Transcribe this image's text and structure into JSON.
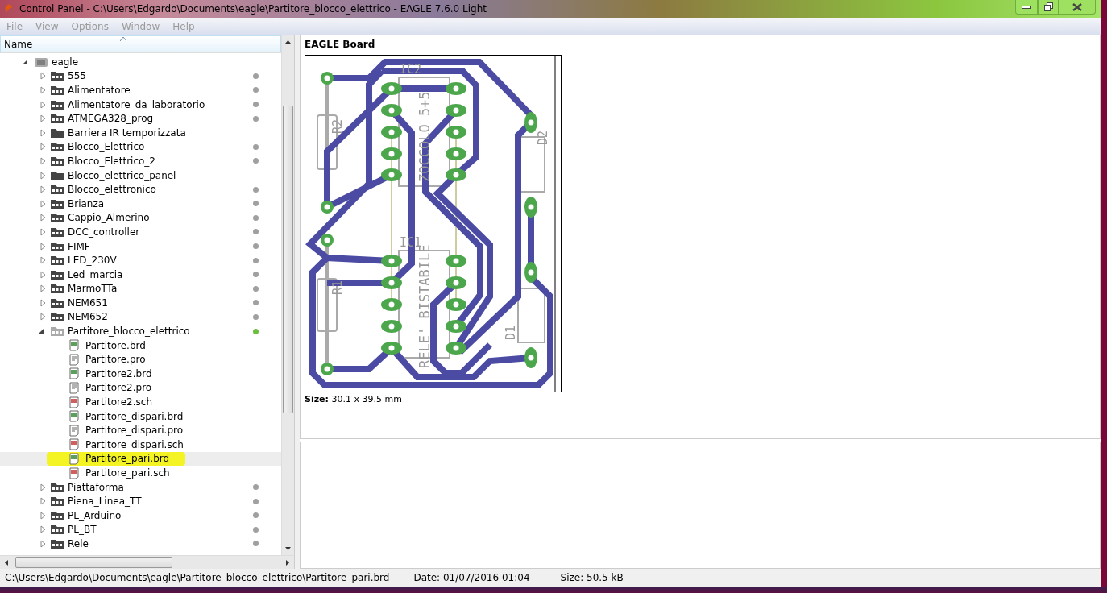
{
  "window": {
    "title": "Control Panel - C:\\Users\\Edgardo\\Documents\\eagle\\Partitore_blocco_elettrico - EAGLE 7.6.0 Light"
  },
  "menu": [
    "File",
    "View",
    "Options",
    "Window",
    "Help"
  ],
  "tree": {
    "column": "Name",
    "nodes": [
      {
        "name": "eagle",
        "kind": "root",
        "expanded": true,
        "selected": false,
        "children": [
          {
            "name": "555",
            "kind": "project",
            "expanded": false,
            "selected": false,
            "color": "#a0a0a0"
          },
          {
            "name": "Alimentatore",
            "kind": "project",
            "expanded": false,
            "selected": false,
            "color": "#a0a0a0"
          },
          {
            "name": "Alimentatore_da_laboratorio",
            "kind": "project",
            "expanded": false,
            "selected": false,
            "color": "#a0a0a0"
          },
          {
            "name": "ATMEGA328_prog",
            "kind": "project",
            "expanded": false,
            "selected": false,
            "color": "#a0a0a0"
          },
          {
            "name": "Barriera IR temporizzata",
            "kind": "folder",
            "expanded": false,
            "selected": false
          },
          {
            "name": "Blocco_Elettrico",
            "kind": "project",
            "expanded": false,
            "selected": false,
            "color": "#a0a0a0"
          },
          {
            "name": "Blocco_Elettrico_2",
            "kind": "project",
            "expanded": false,
            "selected": false,
            "color": "#a0a0a0"
          },
          {
            "name": "Blocco_elettrico_panel",
            "kind": "folder",
            "expanded": false,
            "selected": false
          },
          {
            "name": "Blocco_elettronico",
            "kind": "project",
            "expanded": false,
            "selected": false,
            "color": "#a0a0a0"
          },
          {
            "name": "Brianza",
            "kind": "project",
            "expanded": false,
            "selected": false,
            "color": "#a0a0a0"
          },
          {
            "name": "Cappio_Almerino",
            "kind": "project",
            "expanded": false,
            "selected": false,
            "color": "#a0a0a0"
          },
          {
            "name": "DCC_controller",
            "kind": "project",
            "expanded": false,
            "selected": false,
            "color": "#a0a0a0"
          },
          {
            "name": "FIMF",
            "kind": "project",
            "expanded": false,
            "selected": false,
            "color": "#a0a0a0"
          },
          {
            "name": "LED_230V",
            "kind": "project",
            "expanded": false,
            "selected": false,
            "color": "#a0a0a0"
          },
          {
            "name": "Led_marcia",
            "kind": "project",
            "expanded": false,
            "selected": false,
            "color": "#a0a0a0"
          },
          {
            "name": "MarmoTTa",
            "kind": "project",
            "expanded": false,
            "selected": false,
            "color": "#a0a0a0"
          },
          {
            "name": "NEM651",
            "kind": "project",
            "expanded": false,
            "selected": false,
            "color": "#a0a0a0"
          },
          {
            "name": "NEM652",
            "kind": "project",
            "expanded": false,
            "selected": false,
            "color": "#a0a0a0"
          },
          {
            "name": "Partitore_blocco_elettrico",
            "kind": "project",
            "expanded": true,
            "selected": false,
            "color": "#6cbf3c",
            "children": [
              {
                "name": "Partitore.brd",
                "kind": "brd",
                "selected": false
              },
              {
                "name": "Partitore.pro",
                "kind": "pro",
                "selected": false
              },
              {
                "name": "Partitore2.brd",
                "kind": "brd",
                "selected": false
              },
              {
                "name": "Partitore2.pro",
                "kind": "pro",
                "selected": false
              },
              {
                "name": "Partitore2.sch",
                "kind": "sch",
                "selected": false
              },
              {
                "name": "Partitore_dispari.brd",
                "kind": "brd",
                "selected": false
              },
              {
                "name": "Partitore_dispari.pro",
                "kind": "pro",
                "selected": false
              },
              {
                "name": "Partitore_dispari.sch",
                "kind": "sch",
                "selected": false
              },
              {
                "name": "Partitore_pari.brd",
                "kind": "brd",
                "selected": true
              },
              {
                "name": "Partitore_pari.sch",
                "kind": "sch",
                "selected": false
              }
            ]
          },
          {
            "name": "Piattaforma",
            "kind": "project",
            "expanded": false,
            "selected": false,
            "color": "#a0a0a0"
          },
          {
            "name": "Piena_Linea_TT",
            "kind": "project",
            "expanded": false,
            "selected": false,
            "color": "#a0a0a0"
          },
          {
            "name": "PL_Arduino",
            "kind": "project",
            "expanded": false,
            "selected": false,
            "color": "#a0a0a0"
          },
          {
            "name": "PL_BT",
            "kind": "project",
            "expanded": false,
            "selected": false,
            "color": "#a0a0a0"
          },
          {
            "name": "Rele",
            "kind": "project",
            "expanded": false,
            "selected": false,
            "color": "#a0a0a0"
          }
        ]
      }
    ]
  },
  "preview": {
    "title": "EAGLE Board",
    "board_labels": [
      "IC2",
      "IC1",
      "R2",
      "R1",
      "D2",
      "D1",
      "ZOCCOLO 5+5",
      "RELE' BISTABILE"
    ],
    "size_label": "Size:",
    "size_value": "30.1 x 39.5 mm"
  },
  "status_bar": {
    "path": "C:\\Users\\Edgardo\\Documents\\eagle\\Partitore_blocco_elettrico\\Partitore_pari.brd",
    "date": "Date: 01/07/2016 01:04",
    "size": "Size: 50.5 kB"
  }
}
